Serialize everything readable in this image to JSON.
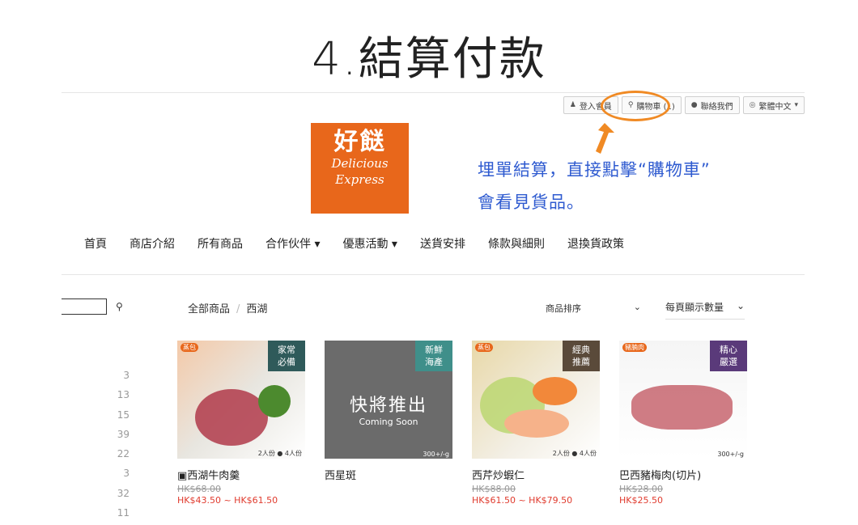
{
  "slide": {
    "title": "4.結算付款",
    "note_line1": "埋單結算，直接點擊“購物車”",
    "note_line2": "會看見貨品。"
  },
  "topbar": {
    "login": "登入會員",
    "cart": "購物車 (1)",
    "contact": "聯絡我們",
    "language": "繁體中文"
  },
  "logo": {
    "line1": "好餸",
    "line2": "Delicious",
    "line3": "Express"
  },
  "nav": [
    "首頁",
    "商店介紹",
    "所有商品",
    "合作伙伴 ▾",
    "優惠活動 ▾",
    "送貨安排",
    "條款與細則",
    "退換貨政策"
  ],
  "breadcrumb": {
    "root": "全部商品",
    "current": "西湖"
  },
  "toolbar": {
    "sort_label": "商品排序",
    "per_page_label": "每頁顯示數量"
  },
  "side_counts": [
    "3",
    "13",
    "15",
    "39",
    "22",
    "3",
    "32",
    "11"
  ],
  "products": [
    {
      "name": "西湖牛肉羹",
      "old_price": "HK$68.00",
      "price": "HK$43.50 ~ HK$61.50",
      "badge": "家常\n必備",
      "tag": "蒸包",
      "portion": "2人份 ● 4人份",
      "bg": "#c64a3c"
    },
    {
      "name": "西星斑",
      "old_price": "",
      "price": "",
      "badge": "新鮮\n海產",
      "tag": "",
      "portion": "300+/-g",
      "bg": "#6a6a6a",
      "coming_a": "快將推出",
      "coming_b": "Coming Soon"
    },
    {
      "name": "西芹炒蝦仁",
      "old_price": "HK$88.00",
      "price": "HK$61.50 ~ HK$79.50",
      "badge": "經典\n推薦",
      "tag": "蒸包",
      "portion": "2人份 ● 4人份",
      "bg": "#d9b66a"
    },
    {
      "name": "巴西豬梅肉(切片)",
      "old_price": "HK$28.00",
      "price": "HK$25.50",
      "badge": "精心\n嚴選",
      "tag": "豬腩肉",
      "portion": "300+/-g",
      "bg": "#b0545e"
    }
  ]
}
